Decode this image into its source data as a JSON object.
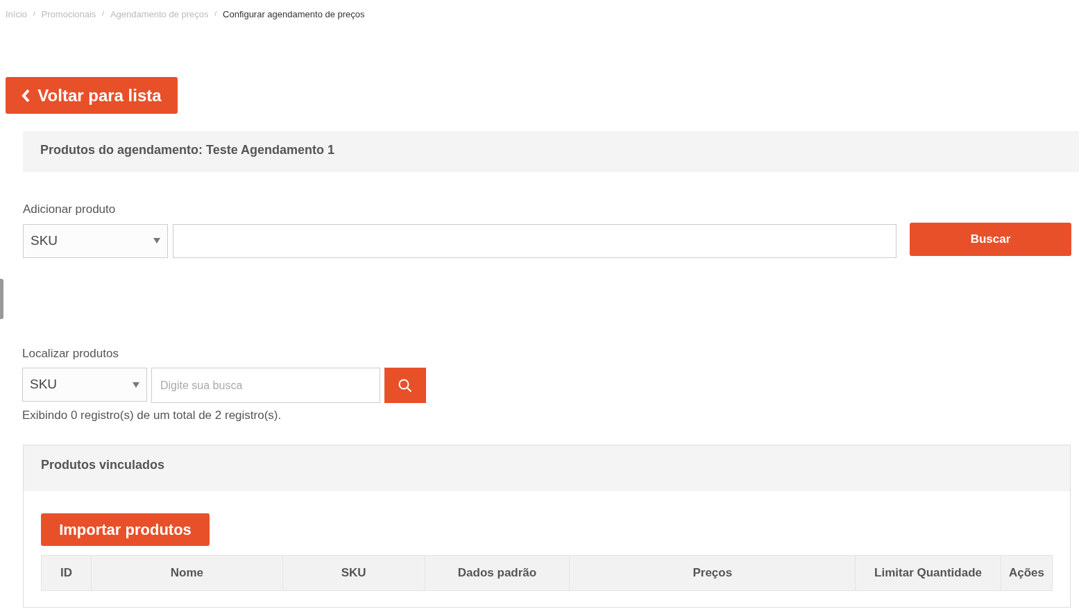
{
  "breadcrumb": {
    "separator": "/",
    "items": [
      {
        "label": "Início",
        "current": false
      },
      {
        "label": "Promocionais",
        "current": false
      },
      {
        "label": "Agendamento de preços",
        "current": false
      },
      {
        "label": "Configurar agendamento de preços",
        "current": true
      }
    ]
  },
  "back_button": {
    "label": "Voltar para lista"
  },
  "schedule_panel": {
    "title": "Produtos do agendamento: Teste Agendamento 1"
  },
  "add_product": {
    "label": "Adicionar produto",
    "select_value": "SKU",
    "button": "Buscar"
  },
  "find_products": {
    "label": "Localizar produtos",
    "select_value": "SKU",
    "placeholder": "Digite sua busca",
    "summary": "Exibindo 0 registro(s) de um total de 2 registro(s)."
  },
  "linked_products": {
    "title": "Produtos vinculados",
    "import_button": "Importar produtos",
    "table": {
      "columns": [
        "ID",
        "Nome",
        "SKU",
        "Dados padrão",
        "Preços",
        "Limitar Quantidade",
        "Ações"
      ]
    }
  }
}
